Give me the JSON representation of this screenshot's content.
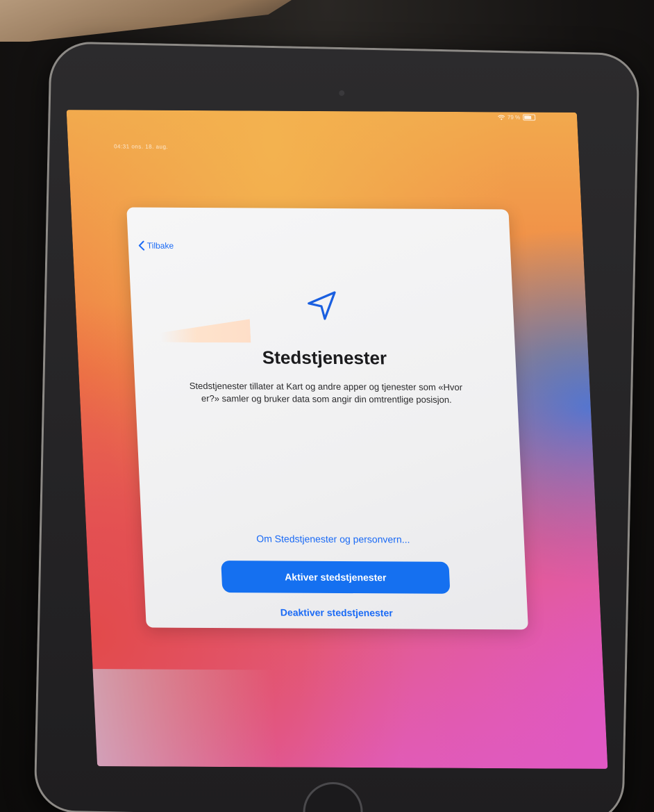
{
  "status_bar": {
    "time": "04:31  ons. 18. aug.",
    "battery": "79 %",
    "battery_level": 0.79
  },
  "dialog": {
    "back_label": "Tilbake",
    "title": "Stedstjenester",
    "description": "Stedstjenester tillater at Kart og andre apper og tjenester som «Hvor er?» samler og bruker data som angir din omtrentlige posisjon.",
    "privacy_link": "Om Stedstjenester og personvern...",
    "primary_button": "Aktiver stedstjenester",
    "secondary_button": "Deaktiver stedstjenester"
  },
  "colors": {
    "accent": "#1570f0",
    "link": "#1a6af5",
    "card": "#f4f4f5"
  },
  "icons": {
    "back": "chevron-left-icon",
    "location": "location-arrow-icon",
    "wifi": "wifi-icon",
    "battery": "battery-icon"
  }
}
